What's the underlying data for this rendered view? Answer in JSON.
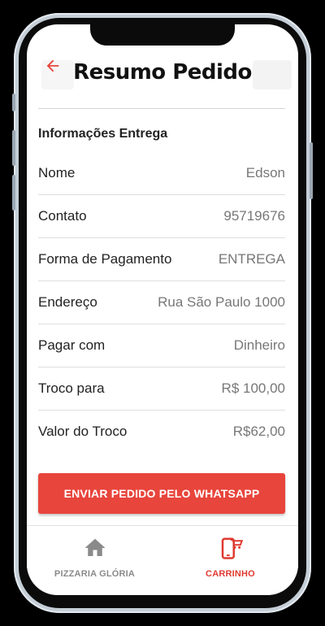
{
  "header": {
    "title": "Resumo Pedido",
    "back_icon": "arrow-left-icon",
    "accent_color": "#e8453c"
  },
  "section": {
    "title": "Informações Entrega"
  },
  "rows": [
    {
      "label": "Nome",
      "value": "Edson"
    },
    {
      "label": "Contato",
      "value": "95719676"
    },
    {
      "label": "Forma de Pagamento",
      "value": "ENTREGA"
    },
    {
      "label": "Endereço",
      "value": "Rua São Paulo 1000"
    },
    {
      "label": "Pagar com",
      "value": "Dinheiro"
    },
    {
      "label": "Troco para",
      "value": "R$ 100,00"
    },
    {
      "label": "Valor do Troco",
      "value": "R$62,00"
    }
  ],
  "send_button": {
    "label": "ENVIAR PEDIDO PELO WHATSAPP"
  },
  "tabs": [
    {
      "label": "PIZZARIA GLÓRIA",
      "icon": "home-icon",
      "active": false
    },
    {
      "label": "CARRINHO",
      "icon": "cart-phone-icon",
      "active": true
    }
  ]
}
